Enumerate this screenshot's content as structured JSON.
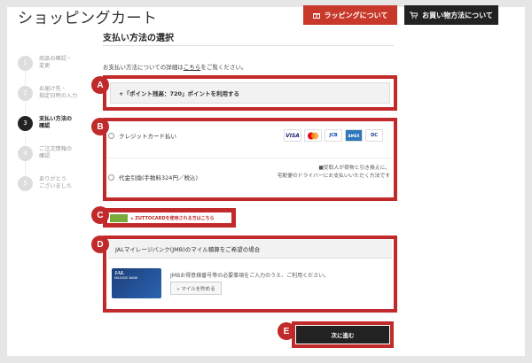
{
  "header": {
    "title": "ショッピングカート",
    "wrapping_button": "ラッピングについて",
    "guide_button": "お買い物方法について"
  },
  "section_title": "支払い方法の選択",
  "steps": [
    {
      "num": "1",
      "label": "商品の確認・\n変更",
      "active": false
    },
    {
      "num": "2",
      "label": "お届け先・\n指定日時の入力",
      "active": false
    },
    {
      "num": "3",
      "label": "支払い方法の\n確認",
      "active": true
    },
    {
      "num": "4",
      "label": "ご注文情報の\n確認",
      "active": false
    },
    {
      "num": "5",
      "label": "ありがとう\nございました",
      "active": false
    }
  ],
  "intro": {
    "before": "お支払い方法についての詳細は",
    "link": "こちら",
    "after": "をご覧ください。"
  },
  "points": {
    "label": "+「ポイント残高：720」ポイントを利用する"
  },
  "payment": {
    "credit_label": "クレジットカード払い",
    "cards": [
      "VISA",
      "MC",
      "JCB",
      "AMEX",
      "DC"
    ],
    "cod_label": "代金引換(手数料324円／税込)",
    "cod_note": "■受取人が荷物と引き換えに、\n宅配便のドライバーにお支払いいただく方法です"
  },
  "zuttocard": {
    "label": "▸ ZUTTOCARDを使用される方はこちら"
  },
  "jmb": {
    "header": "JALマイレージバンク(JMB)のマイル積算をご希望の場合",
    "card_brand": "JAL",
    "card_name": "MILEAGE BANK",
    "description": "JMBお得意様番号等の必要事項をご入力のうえ、ご利用ください。",
    "button": "» マイルを貯める"
  },
  "next_button": "次に進む",
  "markers": [
    "A",
    "B",
    "C",
    "D",
    "E"
  ],
  "colors": {
    "highlight": "#c12a2a",
    "wrap_button": "#c8392b",
    "dark": "#222222"
  }
}
